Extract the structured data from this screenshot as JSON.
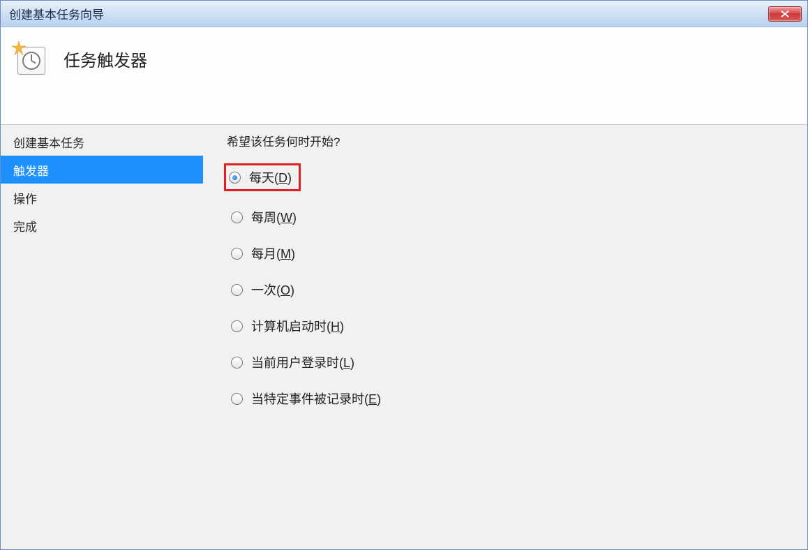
{
  "window": {
    "title": "创建基本任务向导"
  },
  "header": {
    "title": "任务触发器"
  },
  "sidebar": {
    "items": [
      {
        "label": "创建基本任务",
        "selected": false
      },
      {
        "label": "触发器",
        "selected": true
      },
      {
        "label": "操作",
        "selected": false
      },
      {
        "label": "完成",
        "selected": false
      }
    ]
  },
  "main": {
    "question": "希望该任务何时开始?",
    "options": [
      {
        "text": "每天(",
        "accel": "D",
        "suffix": ")",
        "checked": true,
        "highlighted": true
      },
      {
        "text": "每周(",
        "accel": "W",
        "suffix": ")",
        "checked": false,
        "highlighted": false
      },
      {
        "text": "每月(",
        "accel": "M",
        "suffix": ")",
        "checked": false,
        "highlighted": false
      },
      {
        "text": "一次(",
        "accel": "O",
        "suffix": ")",
        "checked": false,
        "highlighted": false
      },
      {
        "text": "计算机启动时(",
        "accel": "H",
        "suffix": ")",
        "checked": false,
        "highlighted": false
      },
      {
        "text": "当前用户登录时(",
        "accel": "L",
        "suffix": ")",
        "checked": false,
        "highlighted": false
      },
      {
        "text": "当特定事件被记录时(",
        "accel": "E",
        "suffix": ")",
        "checked": false,
        "highlighted": false
      }
    ]
  }
}
